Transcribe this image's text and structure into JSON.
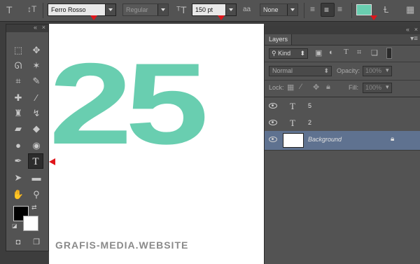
{
  "options_bar": {
    "font_family": "Ferro Rosso",
    "font_style": "Regular",
    "font_size": "150 pt",
    "antialias_label": "aa",
    "antialias_value": "None",
    "text_color": "#69ceb0"
  },
  "canvas": {
    "text": "25",
    "text_color": "#69ceb0"
  },
  "watermark": "GRAFIS-MEDIA.WEBSITE",
  "layers_panel": {
    "tab": "Layers",
    "filter_kind": "Kind",
    "blend_mode": "Normal",
    "opacity_label": "Opacity:",
    "opacity_value": "100%",
    "lock_label": "Lock:",
    "fill_label": "Fill:",
    "fill_value": "100%",
    "layers": [
      {
        "name": "5",
        "type": "text"
      },
      {
        "name": "2",
        "type": "text"
      },
      {
        "name": "Background",
        "type": "image",
        "selected": true
      }
    ]
  },
  "toolbox": {
    "selected_tool": "T"
  }
}
